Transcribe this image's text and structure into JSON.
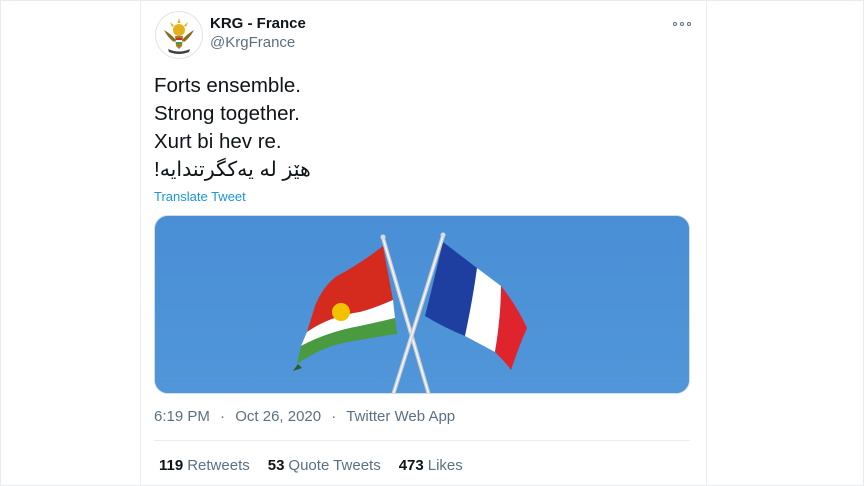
{
  "user": {
    "display_name": "KRG - France",
    "handle": "@KrgFrance"
  },
  "tweet": {
    "lines": [
      "Forts ensemble.",
      "Strong together.",
      "Xurt bi hev re.",
      "هێز له یەکگرتندایە!"
    ],
    "translate_label": "Translate Tweet"
  },
  "meta": {
    "time": "6:19 PM",
    "date": "Oct 26, 2020",
    "source": "Twitter Web App",
    "separator": "·"
  },
  "stats": {
    "retweets_count": "119",
    "retweets_label": "Retweets",
    "quotes_count": "53",
    "quotes_label": "Quote Tweets",
    "likes_count": "473",
    "likes_label": "Likes"
  },
  "colors": {
    "link": "#1b95e0",
    "secondary_text": "#5b7083",
    "sky": "#4d90d5",
    "kurdistan_red": "#d52b1e",
    "kurdistan_green": "#4a9a3f",
    "kurdistan_sun": "#f2c200",
    "france_blue": "#1f3fa0",
    "france_red": "#e0242d"
  },
  "icons": {
    "more": "more-horizontal-icon",
    "avatar": "krg-emblem-icon"
  }
}
